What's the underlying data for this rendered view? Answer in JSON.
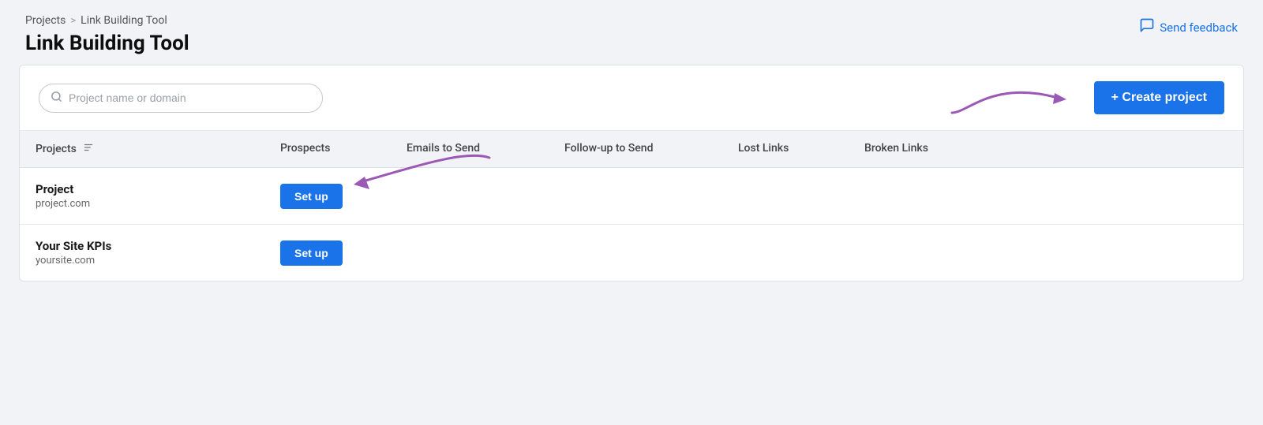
{
  "breadcrumb": {
    "parent": "Projects",
    "separator": ">",
    "current": "Link Building Tool"
  },
  "page": {
    "title": "Link Building Tool"
  },
  "feedback": {
    "label": "Send feedback",
    "icon": "💬"
  },
  "search": {
    "placeholder": "Project name or domain"
  },
  "create_project_btn": {
    "label": "+ Create project"
  },
  "table": {
    "headers": [
      {
        "label": "Projects",
        "has_sort": true
      },
      {
        "label": "Prospects",
        "has_sort": false
      },
      {
        "label": "Emails to Send",
        "has_sort": false
      },
      {
        "label": "Follow-up to Send",
        "has_sort": false
      },
      {
        "label": "Lost Links",
        "has_sort": false
      },
      {
        "label": "Broken Links",
        "has_sort": false
      }
    ],
    "rows": [
      {
        "name": "Project",
        "domain": "project.com",
        "prospects_action": "Set up"
      },
      {
        "name": "Your Site KPIs",
        "domain": "yoursite.com",
        "prospects_action": "Set up"
      }
    ]
  }
}
